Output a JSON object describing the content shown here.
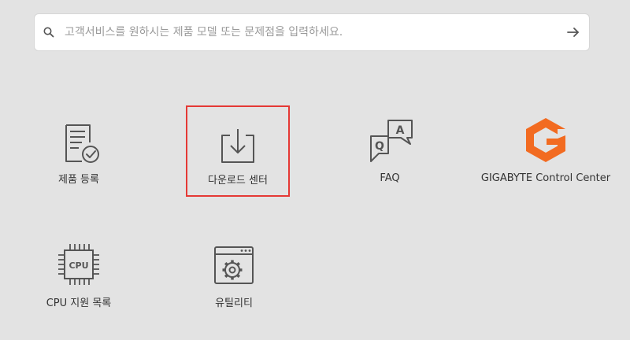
{
  "search": {
    "placeholder": "고객서비스를 원하시는 제품 모델 또는 문제점을 입력하세요.",
    "search_icon": "search-icon",
    "submit_icon": "arrow-right-icon"
  },
  "tiles": [
    {
      "label": "제품 등록",
      "icon": "document-check-icon"
    },
    {
      "label": "다운로드 센터",
      "icon": "download-icon",
      "highlighted": true,
      "highlight_color": "#e53935"
    },
    {
      "label": "FAQ",
      "icon": "qa-chat-icon"
    },
    {
      "label": "GIGABYTE Control Center",
      "icon": "gigabyte-control-center-logo",
      "accent": "#f26b21"
    },
    {
      "label": "CPU 지원 목록",
      "icon": "cpu-chip-icon",
      "chip_text": "CPU"
    },
    {
      "label": "유틸리티",
      "icon": "utility-window-gear-icon"
    }
  ],
  "faq_icon_letters": {
    "q": "Q",
    "a": "A"
  }
}
